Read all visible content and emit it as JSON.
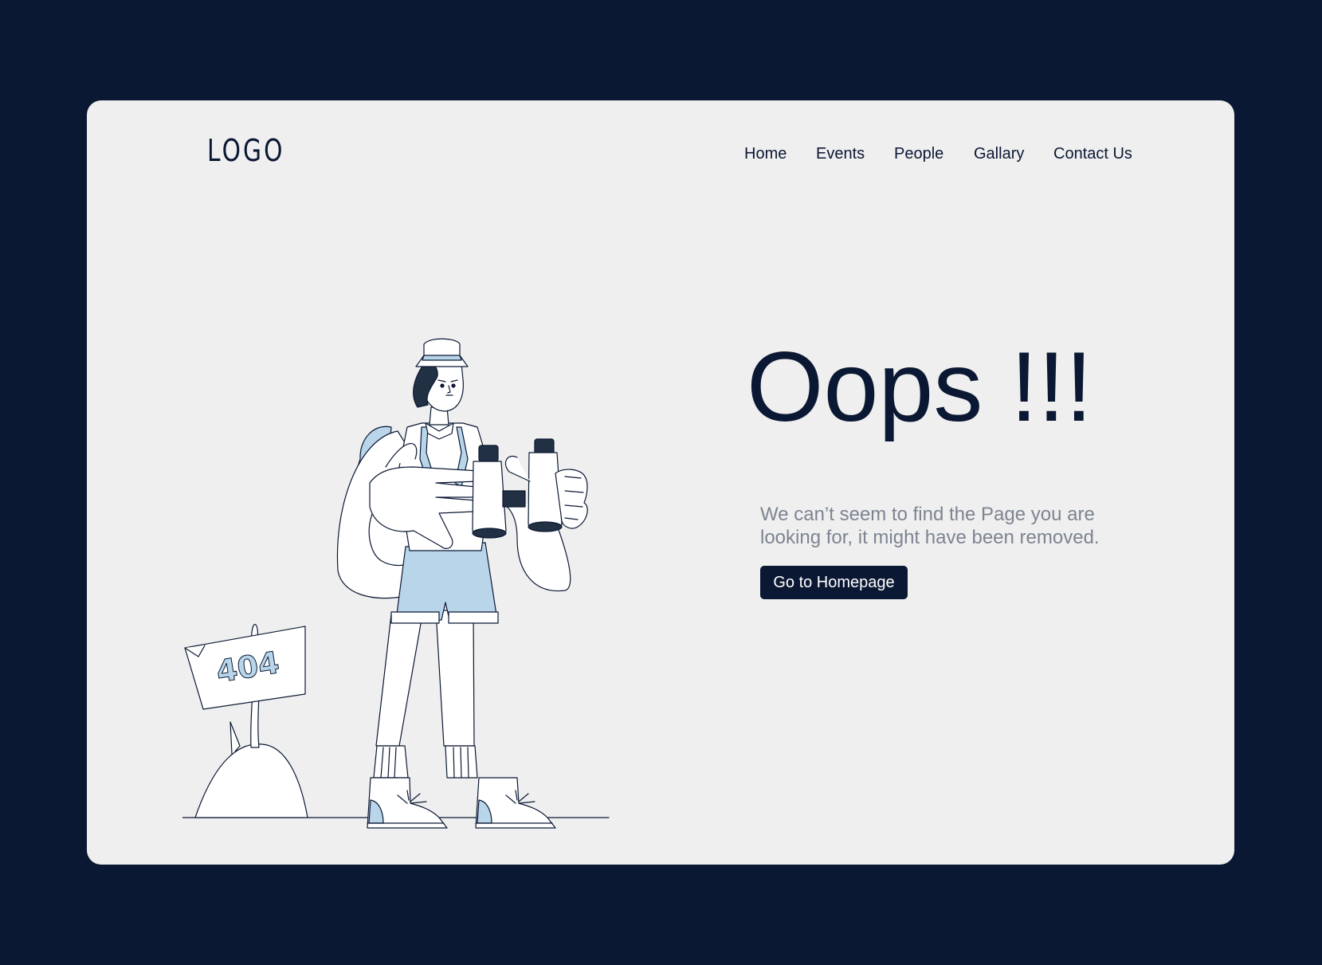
{
  "header": {
    "logo": "LOGO",
    "nav": [
      "Home",
      "Events",
      "People",
      "Gallary",
      "Contact Us"
    ]
  },
  "illustration": {
    "sign_text": "404"
  },
  "main": {
    "headline": "Oops !!!",
    "message": "We can’t seem to find the Page you are looking for, it might have been removed.",
    "cta_label": "Go to Homepage"
  },
  "colors": {
    "background": "#0b1833",
    "card": "#efefef",
    "accent_light_blue": "#b8d5ea",
    "muted_text": "#7d8491"
  }
}
